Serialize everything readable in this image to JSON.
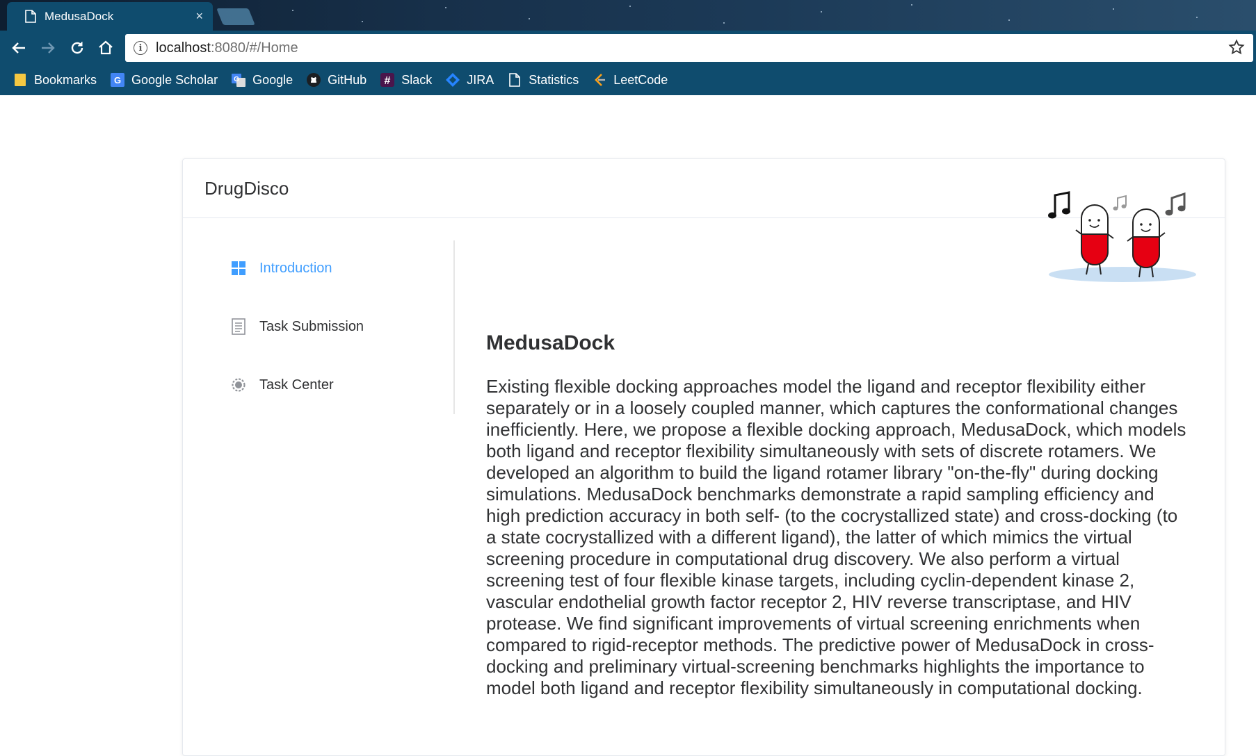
{
  "browser": {
    "tab_title": "MedusaDock",
    "tab_close": "×",
    "url_host": "localhost",
    "url_path": ":8080/#/Home",
    "bookmarks": [
      {
        "label": "Bookmarks",
        "icon": "folder-icon"
      },
      {
        "label": "Google Scholar",
        "icon": "google-scholar-icon"
      },
      {
        "label": "Google",
        "icon": "google-translate-icon"
      },
      {
        "label": "GitHub",
        "icon": "github-icon"
      },
      {
        "label": "Slack",
        "icon": "slack-icon"
      },
      {
        "label": "JIRA",
        "icon": "jira-icon"
      },
      {
        "label": "Statistics",
        "icon": "page-icon"
      },
      {
        "label": "LeetCode",
        "icon": "leetcode-icon"
      }
    ],
    "colors": {
      "toolbar": "#0f4c6e",
      "tabstrip": "#17304a"
    }
  },
  "app": {
    "brand": "DrugDisco",
    "accent_color": "#409eff",
    "menu": [
      {
        "label": "Introduction",
        "icon": "grid-icon",
        "active": true
      },
      {
        "label": "Task Submission",
        "icon": "document-list-icon",
        "active": false
      },
      {
        "label": "Task Center",
        "icon": "gear-icon",
        "active": false
      }
    ],
    "main": {
      "title": "MedusaDock",
      "body": "Existing flexible docking approaches model the ligand and receptor flexibility either separately or in a loosely coupled manner, which captures the conformational changes inefficiently. Here, we propose a flexible docking approach, MedusaDock, which models both ligand and receptor flexibility simultaneously with sets of discrete rotamers. We developed an algorithm to build the ligand rotamer library \"on-the-fly\" during docking simulations. MedusaDock benchmarks demonstrate a rapid sampling efficiency and high prediction accuracy in both self- (to the cocrystallized state) and cross-docking (to a state cocrystallized with a different ligand), the latter of which mimics the virtual screening procedure in computational drug discovery. We also perform a virtual screening test of four flexible kinase targets, including cyclin-dependent kinase 2, vascular endothelial growth factor receptor 2, HIV reverse transcriptase, and HIV protease. We find significant improvements of virtual screening enrichments when compared to rigid-receptor methods. The predictive power of MedusaDock in cross-docking and preliminary virtual-screening benchmarks highlights the importance to model both ligand and receptor flexibility simultaneously in computational docking."
    }
  }
}
